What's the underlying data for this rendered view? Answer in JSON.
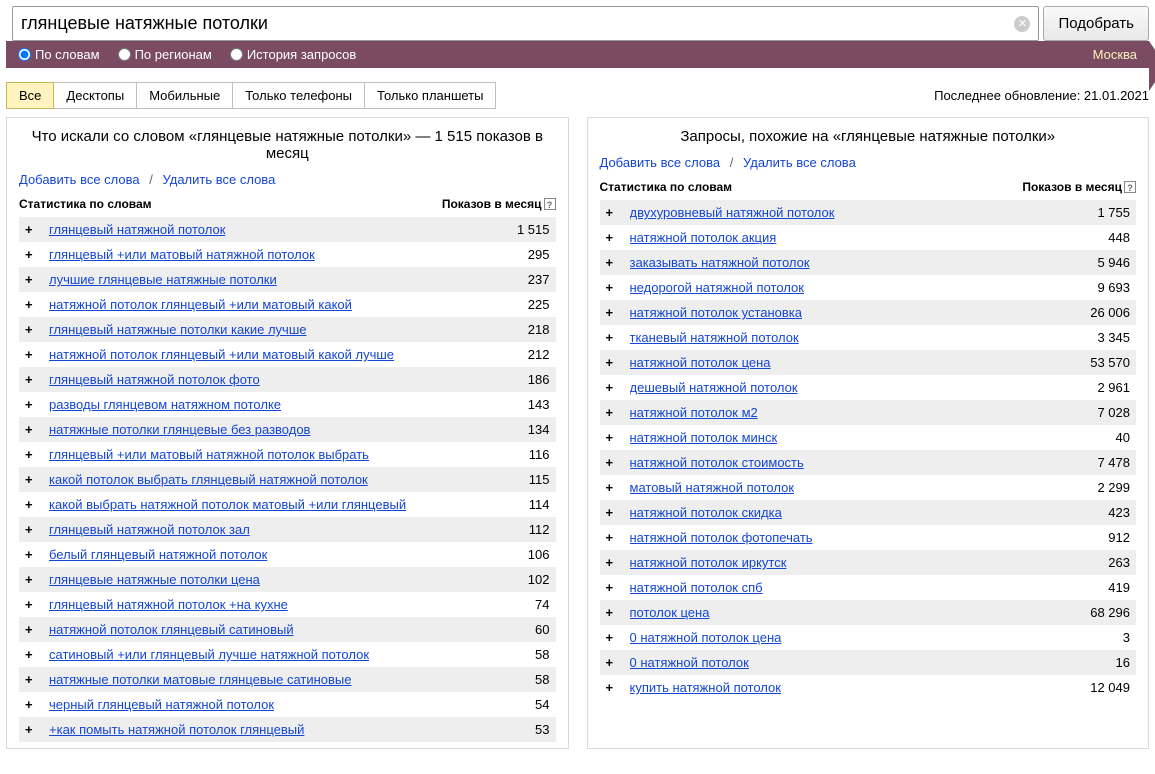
{
  "search": {
    "value": "глянцевые натяжные потолки",
    "submit": "Подобрать"
  },
  "filters": {
    "by_words": "По словам",
    "by_regions": "По регионам",
    "history": "История запросов",
    "region": "Москва"
  },
  "tabs": {
    "all": "Все",
    "desktops": "Десктопы",
    "mobile": "Мобильные",
    "phones": "Только телефоны",
    "tablets": "Только планшеты"
  },
  "update_info": "Последнее обновление: 21.01.2021",
  "left": {
    "title": "Что искали со словом «глянцевые натяжные потолки» — 1 515 показов в месяц",
    "add_all": "Добавить все слова",
    "del_all": "Удалить все слова",
    "h_stats": "Статистика по словам",
    "h_shows": "Показов в месяц",
    "rows": [
      {
        "term": "глянцевый натяжной потолок",
        "count": "1 515"
      },
      {
        "term": "глянцевый +или матовый натяжной потолок",
        "count": "295"
      },
      {
        "term": "лучшие глянцевые натяжные потолки",
        "count": "237"
      },
      {
        "term": "натяжной потолок глянцевый +или матовый какой",
        "count": "225"
      },
      {
        "term": "глянцевый натяжные потолки какие лучше",
        "count": "218"
      },
      {
        "term": "натяжной потолок глянцевый +или матовый какой лучше",
        "count": "212"
      },
      {
        "term": "глянцевый натяжной потолок фото",
        "count": "186"
      },
      {
        "term": "разводы глянцевом натяжном потолке",
        "count": "143"
      },
      {
        "term": "натяжные потолки глянцевые без разводов",
        "count": "134"
      },
      {
        "term": "глянцевый +или матовый натяжной потолок выбрать",
        "count": "116"
      },
      {
        "term": "какой потолок выбрать глянцевый натяжной потолок",
        "count": "115"
      },
      {
        "term": "какой выбрать натяжной потолок матовый +или глянцевый",
        "count": "114"
      },
      {
        "term": "глянцевый натяжной потолок зал",
        "count": "112"
      },
      {
        "term": "белый глянцевый натяжной потолок",
        "count": "106"
      },
      {
        "term": "глянцевые натяжные потолки цена",
        "count": "102"
      },
      {
        "term": "глянцевый натяжной потолок +на кухне",
        "count": "74"
      },
      {
        "term": "натяжной потолок глянцевый сатиновый",
        "count": "60"
      },
      {
        "term": "сатиновый +или глянцевый лучше натяжной потолок",
        "count": "58"
      },
      {
        "term": "натяжные потолки матовые глянцевые сатиновые",
        "count": "58"
      },
      {
        "term": "черный глянцевый натяжной потолок",
        "count": "54"
      },
      {
        "term": "+как помыть натяжной потолок глянцевый",
        "count": "53"
      }
    ]
  },
  "right": {
    "title": "Запросы, похожие на «глянцевые натяжные потолки»",
    "add_all": "Добавить все слова",
    "del_all": "Удалить все слова",
    "h_stats": "Статистика по словам",
    "h_shows": "Показов в месяц",
    "rows": [
      {
        "term": "двухуровневый натяжной потолок",
        "count": "1 755"
      },
      {
        "term": "натяжной потолок акция",
        "count": "448"
      },
      {
        "term": "заказывать натяжной потолок",
        "count": "5 946"
      },
      {
        "term": "недорогой натяжной потолок",
        "count": "9 693"
      },
      {
        "term": "натяжной потолок установка",
        "count": "26 006"
      },
      {
        "term": "тканевый натяжной потолок",
        "count": "3 345"
      },
      {
        "term": "натяжной потолок цена",
        "count": "53 570"
      },
      {
        "term": "дешевый натяжной потолок",
        "count": "2 961"
      },
      {
        "term": "натяжной потолок м2",
        "count": "7 028"
      },
      {
        "term": "натяжной потолок минск",
        "count": "40"
      },
      {
        "term": "натяжной потолок стоимость",
        "count": "7 478"
      },
      {
        "term": "матовый натяжной потолок",
        "count": "2 299"
      },
      {
        "term": "натяжной потолок скидка",
        "count": "423"
      },
      {
        "term": "натяжной потолок фотопечать",
        "count": "912"
      },
      {
        "term": "натяжной потолок иркутск",
        "count": "263"
      },
      {
        "term": "натяжной потолок спб",
        "count": "419"
      },
      {
        "term": "потолок цена",
        "count": "68 296"
      },
      {
        "term": "0 натяжной потолок цена",
        "count": "3"
      },
      {
        "term": "0 натяжной потолок",
        "count": "16"
      },
      {
        "term": "купить натяжной потолок",
        "count": "12 049"
      }
    ]
  }
}
